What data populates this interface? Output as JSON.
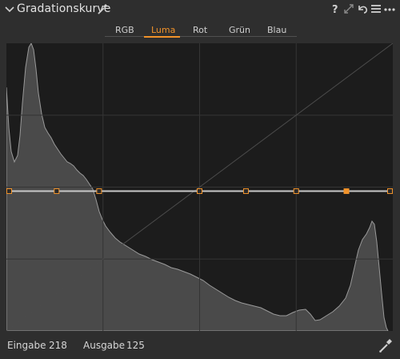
{
  "panel": {
    "title": "Gradationskurve",
    "header_icons": [
      "help-icon",
      "expand-icon",
      "reset-icon",
      "menu-icon",
      "more-icon"
    ]
  },
  "tabs": [
    {
      "label": "RGB",
      "active": false
    },
    {
      "label": "Luma",
      "active": true
    },
    {
      "label": "Rot",
      "active": false
    },
    {
      "label": "Grün",
      "active": false
    },
    {
      "label": "Blau",
      "active": false
    }
  ],
  "footer": {
    "input_label": "Eingabe",
    "input_value": "218",
    "output_label": "Ausgabe",
    "output_value": "125"
  },
  "colors": {
    "accent": "#f0922a",
    "graph_background": "#1c1c1c",
    "histogram_fill": "#4a4a4a",
    "curve_line": "#c8c8c8"
  },
  "curve": {
    "output_level": 0.486,
    "control_points_input": [
      0,
      0.13,
      0.24,
      0.5,
      0.62,
      0.75,
      0.88,
      1.0
    ],
    "selected_point_index": 6
  }
}
